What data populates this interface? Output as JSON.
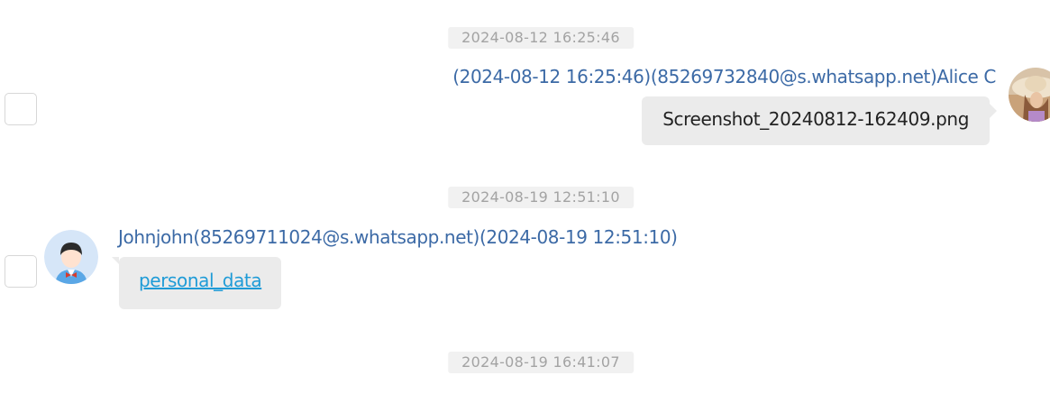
{
  "messages": [
    {
      "timestamp": "2024-08-12 16:25:46",
      "direction": "outgoing",
      "header": "(2024-08-12 16:25:46)(85269732840@s.whatsapp.net)Alice C",
      "body": "Screenshot_20240812-162409.png",
      "avatar_icon": "user-photo-avatar-icon"
    },
    {
      "timestamp": "2024-08-19 12:51:10",
      "direction": "incoming",
      "header": "Johnjohn(85269711024@s.whatsapp.net)(2024-08-19 12:51:10)",
      "body": "personal_data",
      "body_is_link": true,
      "avatar_icon": "default-user-avatar-icon"
    },
    {
      "timestamp": "2024-08-19 16:41:07"
    }
  ],
  "colors": {
    "sender_text": "#3c6aa6",
    "link": "#1e9bd7",
    "bubble": "#ebebeb",
    "timestamp_bg": "#f1f1f1",
    "timestamp_text": "#a3a3a3"
  }
}
